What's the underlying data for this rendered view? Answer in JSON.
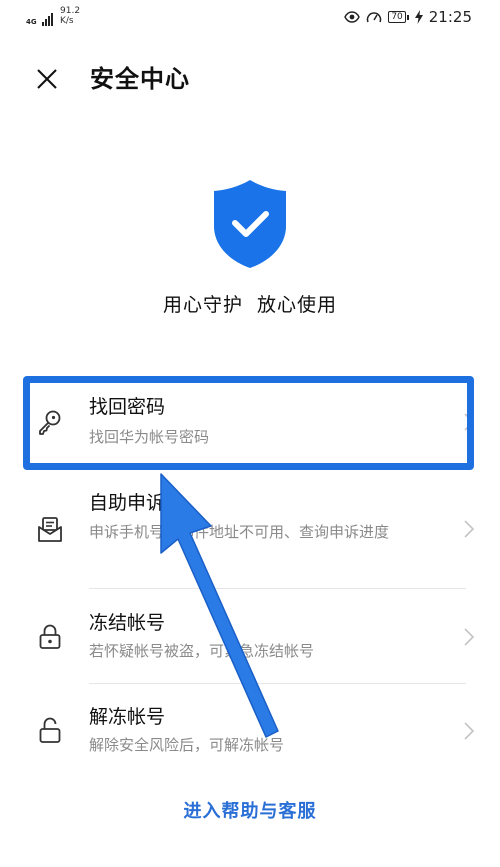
{
  "status_bar": {
    "network": "4G",
    "speed_value": "91.2",
    "speed_unit": "K/s",
    "battery": "70",
    "time": "21:25",
    "icons": [
      "eye-icon",
      "speedometer-icon",
      "battery-icon",
      "charging-icon"
    ]
  },
  "header": {
    "title": "安全中心",
    "close_icon": "close-icon"
  },
  "hero": {
    "icon": "shield-check-icon",
    "slogan": "用心守护  放心使用"
  },
  "list": {
    "items": [
      {
        "title": "找回密码",
        "desc": "找回华为帐号密码",
        "icon": "key-icon"
      },
      {
        "title": "自助申诉",
        "desc": "申诉手机号或邮件地址不可用、查询申诉进度",
        "icon": "appeal-mail-icon"
      },
      {
        "title": "冻结帐号",
        "desc": "若怀疑帐号被盗，可紧急冻结帐号",
        "icon": "lock-closed-icon"
      },
      {
        "title": "解冻帐号",
        "desc": "解除安全风险后，可解冻帐号",
        "icon": "lock-open-icon"
      }
    ]
  },
  "footer": {
    "help_link": "进入帮助与客服"
  },
  "colors": {
    "accent": "#1e6fe0",
    "shield": "#1a73e8",
    "link": "#2a6fd6",
    "text_primary": "#111111",
    "text_secondary": "#8a8a8a",
    "divider": "#e6e6e6"
  }
}
